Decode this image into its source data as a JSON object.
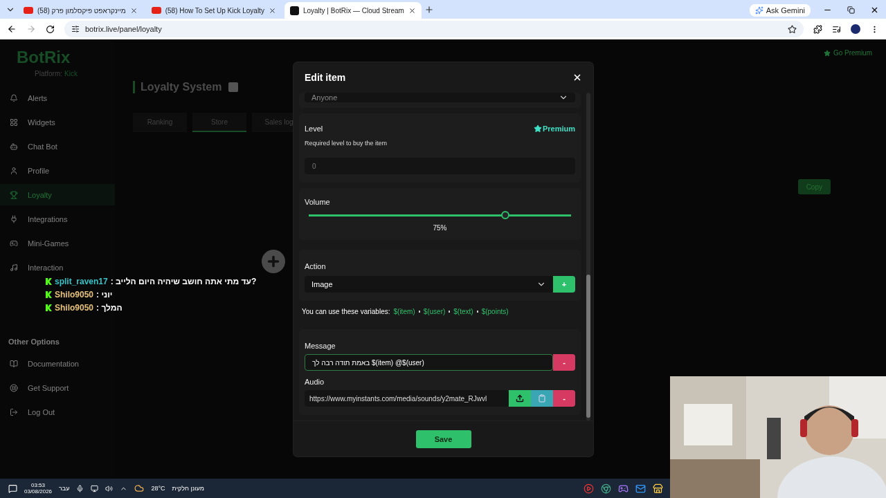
{
  "browser": {
    "tabs": [
      {
        "title": "(58) מיינקראפט פיקסלמון פרק",
        "kind": "video",
        "selected": false
      },
      {
        "title": "(58) How To Set Up Kick Loyalty",
        "kind": "video",
        "selected": false
      },
      {
        "title": "Loyalty | BotRix — Cloud Stream",
        "kind": "site",
        "selected": true
      }
    ],
    "gemini": "Ask Gemini",
    "url": "botrix.live/panel/loyalty"
  },
  "app": {
    "logo": "BotRix",
    "platform_label": "Platform:",
    "platform": "Kick",
    "premium": "Go Premium",
    "nav": [
      {
        "label": "Alerts",
        "selected": false
      },
      {
        "label": "Widgets",
        "selected": false
      },
      {
        "label": "Chat Bot",
        "selected": false
      },
      {
        "label": "Profile",
        "selected": false
      },
      {
        "label": "Loyalty",
        "selected": true
      },
      {
        "label": "Integrations",
        "selected": false
      },
      {
        "label": "Mini-Games",
        "selected": false
      },
      {
        "label": "Interaction",
        "selected": false
      }
    ],
    "other_heading": "Other Options",
    "other": [
      "Documentation",
      "Get Support",
      "Log Out"
    ],
    "page_title": "Loyalty System",
    "tabs": [
      {
        "label": "Ranking",
        "selected": false
      },
      {
        "label": "Store",
        "selected": true
      },
      {
        "label": "Sales log",
        "selected": false
      }
    ],
    "copy": "Copy"
  },
  "modal": {
    "title": "Edit item",
    "access": "Anyone",
    "level": {
      "label": "Level",
      "premium": "Premium",
      "hint": "Required level to buy the item",
      "placeholder": "0"
    },
    "volume": {
      "label": "Volume",
      "level": 0.75,
      "reading": "75%"
    },
    "action": {
      "label": "Action",
      "value": "Image",
      "add": "+"
    },
    "variables": {
      "intro": "You can use these variables:",
      "items": [
        "$(item)",
        "$(user)",
        "$(text)",
        "$(points)"
      ]
    },
    "message": {
      "label": "Message",
      "value": "באמת תודה רבה לך $(item) @$(user)",
      "remove": "-"
    },
    "audio": {
      "label": "Audio",
      "value": "https://www.myinstants.com/media/sounds/y2mate_RJwvl",
      "remove": "-"
    },
    "save": "Save"
  },
  "chat": [
    {
      "user": "split_raven17",
      "message": ": עד מתי אתה חושב שיהיה היום הלייב?",
      "color": "#35c3c8"
    },
    {
      "user": "Shilo9050",
      "message": ": יוני",
      "color": "#e6c27c"
    },
    {
      "user": "Shilo9050",
      "message": ": המלך",
      "color": "#e6c27c"
    }
  ],
  "taskbar": {
    "time": "03:53",
    "date": "03/08/2026",
    "lang": "עבר",
    "temp": "28°C",
    "weather": "מעונן חלקית"
  }
}
